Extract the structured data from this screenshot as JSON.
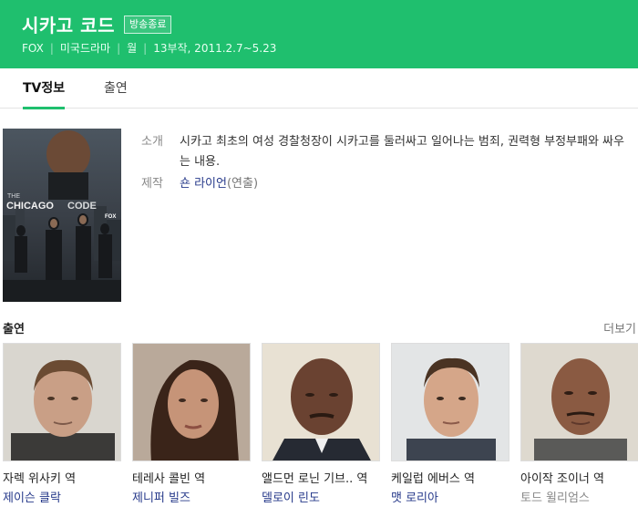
{
  "header": {
    "title": "시카고 코드",
    "status_badge": "방송종료",
    "meta": [
      "FOX",
      "미국드라마",
      "월",
      "13부작, 2011.2.7~5.23"
    ]
  },
  "tabs": [
    {
      "label": "TV정보",
      "active": true
    },
    {
      "label": "출연",
      "active": false
    }
  ],
  "poster": {
    "title_text": "THE CHICAGO CODE",
    "network": "FOX"
  },
  "info": {
    "intro_label": "소개",
    "intro_text": "시카고 최초의 여성 경찰청장이 시카고를 둘러싸고 일어나는 범죄, 권력형 부정부패와 싸우는 내용.",
    "production_label": "제작",
    "producer_name": "숀 라이언",
    "producer_role": "(연출)"
  },
  "cast_section": {
    "heading": "출연",
    "more": "더보기"
  },
  "cast": [
    {
      "role": "자렉 위사키 역",
      "actor": "제이슨 클락",
      "linked": true
    },
    {
      "role": "테레사 콜빈 역",
      "actor": "제니퍼 빌즈",
      "linked": true
    },
    {
      "role": "앨드먼 로닌 기브.. 역",
      "actor": "델로이 린도",
      "linked": true
    },
    {
      "role": "케일럽 에버스 역",
      "actor": "맷 로리아",
      "linked": true
    },
    {
      "role": "아이작 조이너 역",
      "actor": "토드 윌리엄스",
      "linked": false
    }
  ],
  "colors": {
    "accent": "#1fbf6e",
    "link": "#26398a"
  }
}
